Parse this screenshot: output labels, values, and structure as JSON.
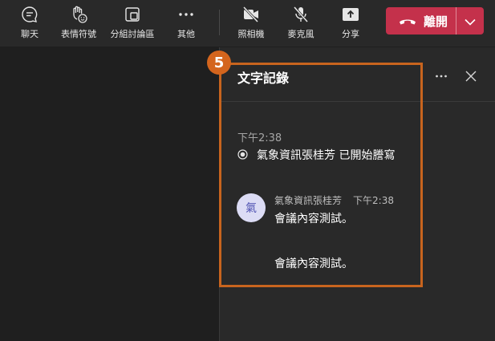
{
  "toolbar": {
    "chat_label": "聊天",
    "reactions_label": "表情符號",
    "breakout_label": "分組討論區",
    "more_label": "其他",
    "camera_label": "照相機",
    "mic_label": "麥克風",
    "share_label": "分享",
    "leave_label": "離開"
  },
  "transcript": {
    "title": "文字記錄",
    "start_time": "下午2:38",
    "system_message": "氣象資訊張桂芳 已開始謄寫",
    "entry": {
      "avatar_initial": "氣",
      "author": "氣象資訊張桂芳",
      "time": "下午2:38",
      "text": "會議內容測試。"
    },
    "entry_continued_text": "會議內容測試。"
  },
  "annotation": {
    "step_number": "5",
    "color": "#c8641e"
  },
  "colors": {
    "leave_button": "#c4314b",
    "toolbar_bg": "#292929",
    "panel_bg": "#292929",
    "avatar_bg": "#dcdcf5",
    "avatar_text": "#4f52b2"
  }
}
